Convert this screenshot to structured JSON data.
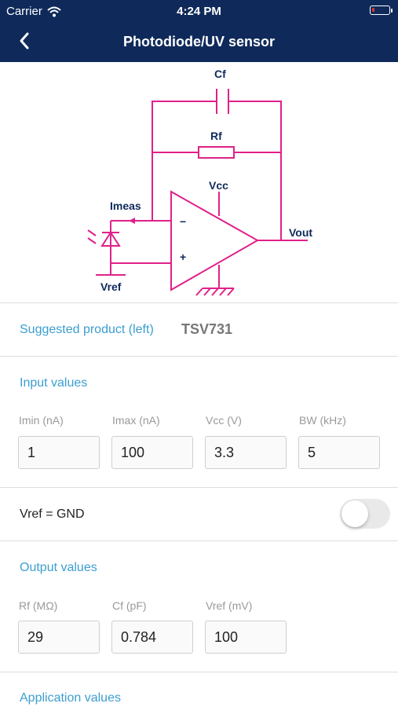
{
  "status_bar": {
    "carrier": "Carrier",
    "time": "4:24 PM",
    "battery_level": 0.15
  },
  "header": {
    "title": "Photodiode/UV sensor"
  },
  "schematic": {
    "labels": {
      "cf": "Cf",
      "rf": "Rf",
      "vcc": "Vcc",
      "imeas": "Imeas",
      "vout": "Vout",
      "vref": "Vref",
      "minus": "−",
      "plus": "+"
    },
    "color": "#e0218a"
  },
  "suggested": {
    "label": "Suggested product (left)",
    "value": "TSV731"
  },
  "inputs": {
    "title": "Input values",
    "fields": [
      {
        "label": "Imin (nA)",
        "value": "1"
      },
      {
        "label": "Imax (nA)",
        "value": "100"
      },
      {
        "label": "Vcc (V)",
        "value": "3.3"
      },
      {
        "label": "BW (kHz)",
        "value": "5"
      }
    ]
  },
  "vref_toggle": {
    "label": "Vref = GND",
    "on": false
  },
  "outputs": {
    "title": "Output values",
    "fields": [
      {
        "label": "Rf (MΩ)",
        "value": "29"
      },
      {
        "label": "Cf (pF)",
        "value": "0.784"
      },
      {
        "label": "Vref (mV)",
        "value": "100"
      }
    ]
  },
  "application": {
    "title": "Application values"
  },
  "colors": {
    "nav": "#0f2a5a",
    "accent": "#3c9ed0",
    "circuit": "#e0218a"
  }
}
